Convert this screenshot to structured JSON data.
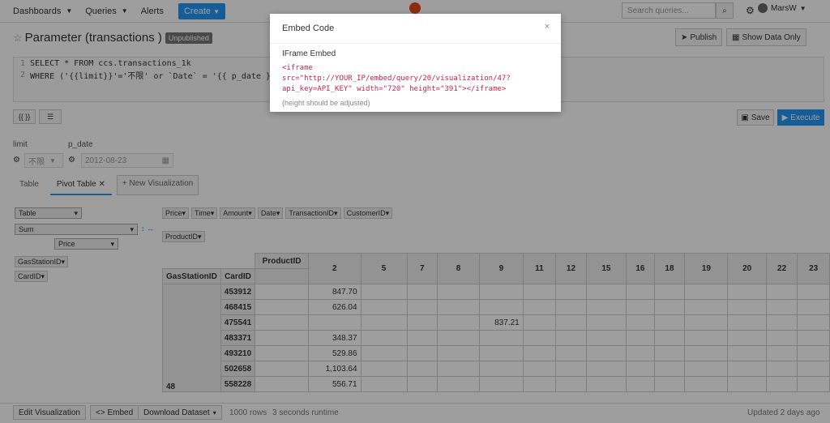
{
  "nav": {
    "dashboards": "Dashboards",
    "queries": "Queries",
    "alerts": "Alerts",
    "create": "Create",
    "search_placeholder": "Search queries...",
    "user": "MarsW"
  },
  "page": {
    "title": "Parameter (transactions )",
    "badge": "Unpublished",
    "publish": "Publish",
    "show_data_only": "Show Data Only"
  },
  "editor": {
    "lines": [
      {
        "num": "1",
        "text": "SELECT * FROM ccs.transactions_1k"
      },
      {
        "num": "2",
        "text": "WHERE ('{{limit}}'='不限' or `Date` = '{{ p_date }"
      }
    ]
  },
  "toolbar": {
    "param_button": "{{ }}",
    "format_button": "☰",
    "save": "Save",
    "execute": "Execute"
  },
  "params": {
    "limit_label": "limit",
    "limit_value": "不限",
    "date_label": "p_date",
    "date_value": "2012-08-23"
  },
  "tabs": {
    "table": "Table",
    "pivot": "Pivot Table",
    "new_viz": "+ New Visualization"
  },
  "pivot": {
    "renderer": "Table",
    "aggregator": "Sum",
    "value_field": "Price",
    "unused_fields": [
      "Price",
      "Time",
      "Amount",
      "Date",
      "TransactionID",
      "CustomerID"
    ],
    "col_fields": [
      "ProductID"
    ],
    "row_fields": [
      "GasStationID",
      "CardID"
    ],
    "col_header_label": "ProductID",
    "row_header_labels": [
      "GasStationID",
      "CardID"
    ],
    "columns": [
      "2",
      "5",
      "7",
      "8",
      "9",
      "11",
      "12",
      "15",
      "16",
      "18",
      "19",
      "20",
      "22",
      "23"
    ],
    "group_label": "48",
    "rows": [
      {
        "card": "453912",
        "values": {
          "2": "847.70"
        }
      },
      {
        "card": "468415",
        "values": {
          "2": "626.04"
        }
      },
      {
        "card": "475541",
        "values": {
          "9": "837.21"
        }
      },
      {
        "card": "483371",
        "values": {
          "2": "348.37"
        }
      },
      {
        "card": "493210",
        "values": {
          "2": "529.86"
        }
      },
      {
        "card": "502658",
        "values": {
          "2": "1,103.64"
        }
      },
      {
        "card": "558228",
        "values": {
          "2": "556.71"
        }
      }
    ]
  },
  "modal": {
    "title": "Embed Code",
    "close": "×",
    "subtitle": "IFrame Embed",
    "code": "<iframe\nsrc=\"http://YOUR_IP/embed/query/20/visualization/47?\napi_key=API_KEY\" width=\"720\" height=\"391\"></iframe>",
    "note": "(height should be adjusted)"
  },
  "bottom": {
    "edit_viz": "Edit Visualization",
    "embed": "<> Embed",
    "download": "Download Dataset",
    "rows": "1000 rows",
    "runtime": "3 seconds runtime",
    "updated": "Updated 2 days ago"
  }
}
